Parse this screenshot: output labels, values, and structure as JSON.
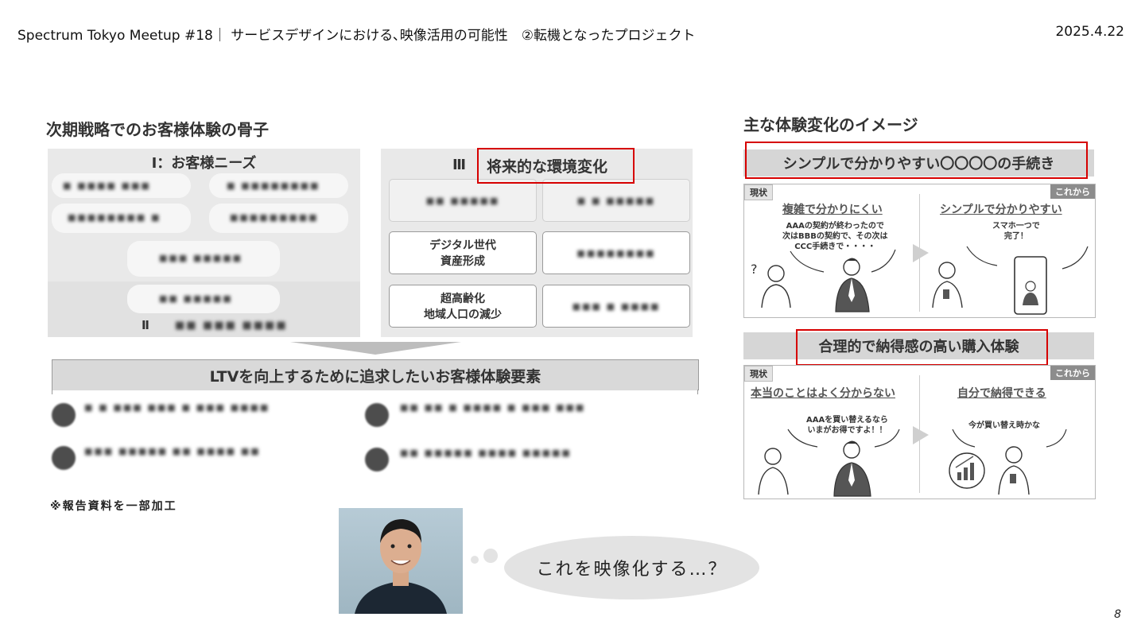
{
  "header": {
    "title": "Spectrum Tokyo Meetup #18｜ サービスデザインにおける､映像活用の可能性　②転機となったプロジェクト",
    "date": "2025.4.22"
  },
  "left": {
    "section_title": "次期戦略でのお客様体験の骨子",
    "panel1_title": "Ⅰ：お客様ニーズ",
    "panel3_prefix": "Ⅲ",
    "panel3_title": "将来的な環境変化",
    "panel2_label_prefix": "Ⅱ",
    "panel1_blurred": [
      "■ ■■■■ ■■■",
      "■ ■■■■■■■■",
      "■■■■■■■■ ■",
      "■■■■■■■■■",
      "■■■ ■■■■■",
      "■■ ■■■■■",
      "■■ ■■■ ■■■■"
    ],
    "boxes": [
      {
        "text": "デジタル世代\n資産形成"
      },
      {
        "text": "超高齢化\n地域人口の減少"
      }
    ],
    "box_blurred": [
      "■■ ■■■■■",
      "■ ■ ■■■■■",
      "■■■■■■■■",
      "■ ■ ■■■■■",
      "■■■ ■ ■■■■"
    ],
    "banner": "LTVを向上するために追求したいお客様体験要素",
    "rows_blurred": [
      "■ ■ ■■■ ■■■ ■ ■■■ ■■■■",
      "■■ ■■ ■ ■■■■ ■ ■■■ ■■■",
      "■■■ ■■■■■ ■■ ■■■■ ■■",
      "■■ ■■■■■ ■■■■ ■■■■■"
    ],
    "note": "※報告資料を一部加工"
  },
  "right": {
    "section_title": "主な体験変化のイメージ",
    "card1": {
      "banner": "シンプルで分かりやすい〇〇〇〇の手続き",
      "tag_now": "現状",
      "tag_next": "これから",
      "left_title": "複雑で分かりにくい",
      "left_speech": "AAAの契約が終わったので\n次はBBBの契約で、その次は\nCCC手続きで・・・・",
      "right_title": "シンプルで分かりやすい",
      "right_speech": "スマホ一つで\n完了！"
    },
    "card2": {
      "banner": "合理的で納得感の高い購入体験",
      "tag_now": "現状",
      "tag_next": "これから",
      "left_title": "本当のことはよく分からない",
      "left_speech": "AAAを買い替えるなら\nいまがお得ですよ！！",
      "right_title": "自分で納得できる",
      "right_speech": "今が買い替え時かな"
    }
  },
  "bubble": {
    "text": "これを映像化する…？"
  },
  "page_number": "8"
}
